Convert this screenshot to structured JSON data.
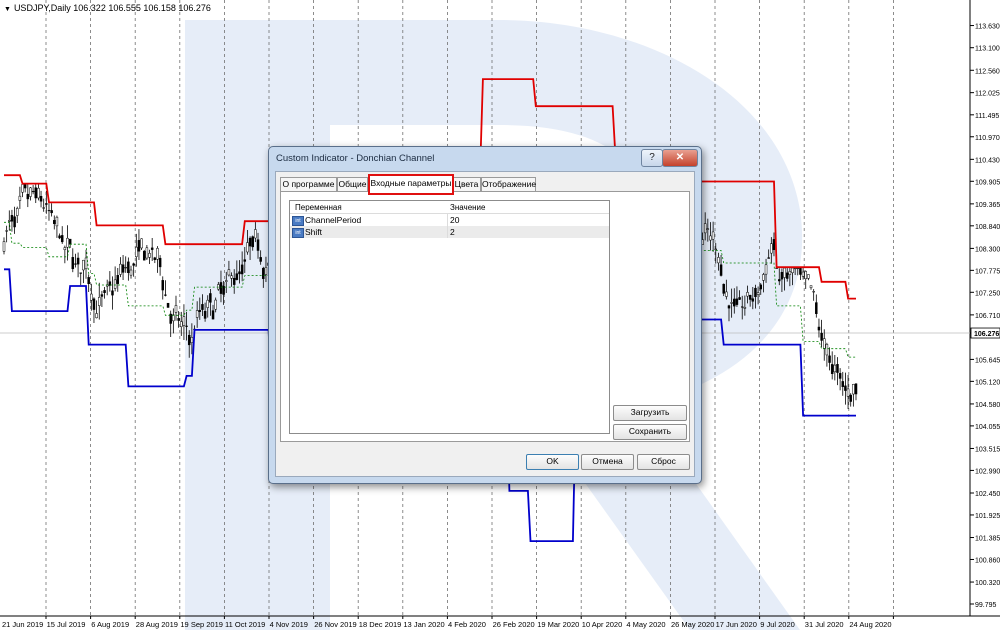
{
  "symbol_label": "USDJPY,Daily  106.322 106.555 106.158 106.276",
  "colors": {
    "upper_channel": "#e00000",
    "lower_channel": "#0000cc",
    "middle_channel": "#008000",
    "candles": "#000000",
    "dialog_accent": "#e01010"
  },
  "chart_data": {
    "type": "candlestick",
    "symbol": "USDJPY",
    "timeframe": "Daily",
    "ylim": [
      99.795,
      113.93
    ],
    "y_ticks": [
      "113.630",
      "113.100",
      "112.560",
      "112.025",
      "111.495",
      "110.970",
      "110.430",
      "109.905",
      "109.365",
      "108.840",
      "108.300",
      "107.775",
      "107.250",
      "106.710",
      "106.276",
      "105.645",
      "105.120",
      "104.580",
      "104.055",
      "103.515",
      "102.990",
      "102.450",
      "101.925",
      "101.385",
      "100.860",
      "100.320",
      "99.795"
    ],
    "current_price": "106.276",
    "x_ticks": [
      "21 Jun 2019",
      "15 Jul 2019",
      "6 Aug 2019",
      "28 Aug 2019",
      "19 Sep 2019",
      "11 Oct 2019",
      "4 Nov 2019",
      "26 Nov 2019",
      "18 Dec 2019",
      "13 Jan 2020",
      "4 Feb 2020",
      "26 Feb 2020",
      "19 Mar 2020",
      "10 Apr 2020",
      "4 May 2020",
      "26 May 2020",
      "17 Jun 2020",
      "9 Jul 2020",
      "31 Jul 2020",
      "24 Aug 2020"
    ],
    "upper_series": [
      [
        0,
        110.05
      ],
      [
        6,
        110.05
      ],
      [
        7,
        109.85
      ],
      [
        16,
        109.85
      ],
      [
        17,
        109.4
      ],
      [
        34,
        109.4
      ],
      [
        35,
        108.85
      ],
      [
        60,
        108.85
      ],
      [
        61,
        108.4
      ],
      [
        90,
        108.4
      ],
      [
        91,
        108.95
      ],
      [
        108,
        108.95
      ],
      [
        109,
        109.55
      ],
      [
        160,
        109.55
      ],
      [
        161,
        110.3
      ],
      [
        180,
        110.3
      ],
      [
        181,
        112.35
      ],
      [
        200,
        112.35
      ],
      [
        201,
        111.7
      ],
      [
        230,
        111.7
      ],
      [
        231,
        110.6
      ],
      [
        255,
        110.6
      ],
      [
        256,
        109.9
      ],
      [
        291,
        109.9
      ],
      [
        292,
        107.85
      ],
      [
        308,
        107.85
      ],
      [
        309,
        107.5
      ],
      [
        318,
        107.5
      ],
      [
        319,
        107.1
      ],
      [
        322,
        107.1
      ]
    ],
    "lower_series": [
      [
        0,
        107.8
      ],
      [
        2,
        107.8
      ],
      [
        3,
        106.8
      ],
      [
        24,
        106.8
      ],
      [
        25,
        107.4
      ],
      [
        31,
        107.4
      ],
      [
        32,
        106.0
      ],
      [
        46,
        106.0
      ],
      [
        47,
        105.0
      ],
      [
        68,
        105.0
      ],
      [
        69,
        105.25
      ],
      [
        71,
        105.25
      ],
      [
        72,
        106.35
      ],
      [
        100,
        106.35
      ],
      [
        101,
        104.9
      ],
      [
        190,
        104.9
      ],
      [
        191,
        102.5
      ],
      [
        198,
        102.5
      ],
      [
        199,
        101.3
      ],
      [
        215,
        101.3
      ],
      [
        216,
        104.3
      ],
      [
        260,
        104.3
      ],
      [
        261,
        106.6
      ],
      [
        271,
        106.6
      ],
      [
        272,
        106.0
      ],
      [
        301,
        106.0
      ],
      [
        302,
        104.3
      ],
      [
        322,
        104.3
      ]
    ],
    "middle_series": "derived as the average of upper and lower channel at each bar"
  },
  "dialog": {
    "title": "Custom Indicator - Donchian Channel",
    "help": "?",
    "close": "✕",
    "tabs": [
      "О программе",
      "Общие",
      "Входные параметры",
      "Цвета",
      "Отображение"
    ],
    "active_tab": "Входные параметры",
    "columns": [
      "Переменная",
      "Значение"
    ],
    "params": [
      {
        "icon": "int",
        "name": "ChannelPeriod",
        "value": "20"
      },
      {
        "icon": "int",
        "name": "Shift",
        "value": "2"
      }
    ],
    "buttons": {
      "load": "Загрузить",
      "save": "Сохранить",
      "ok": "OK",
      "cancel": "Отмена",
      "reset": "Сброс"
    }
  }
}
